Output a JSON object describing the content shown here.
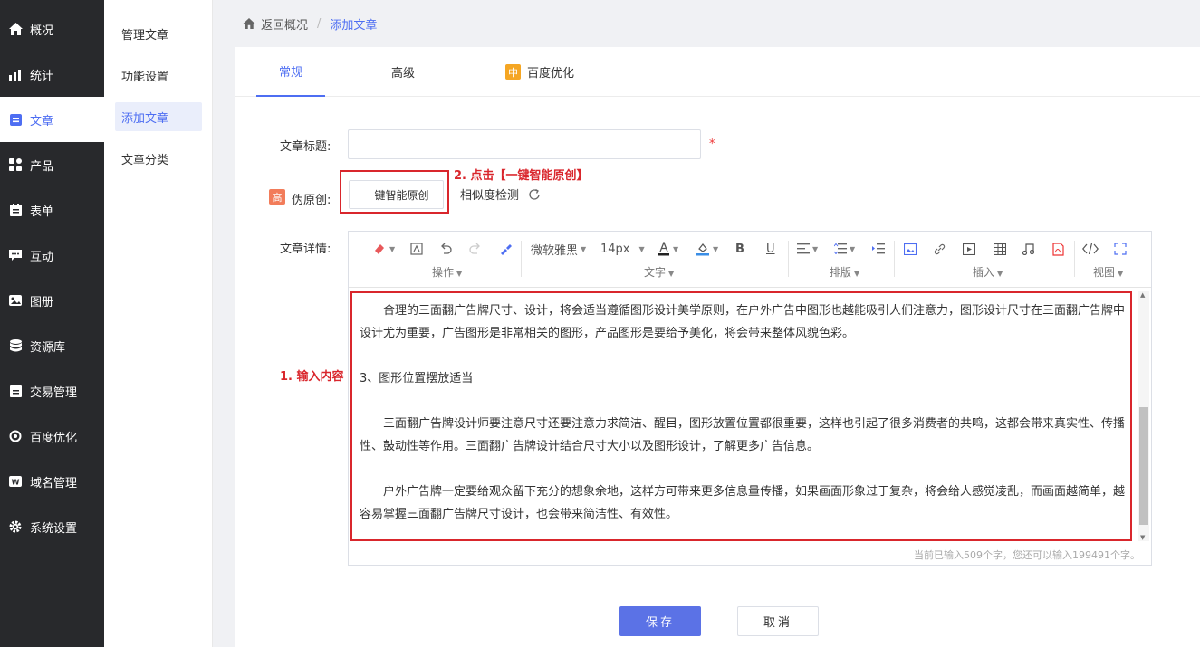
{
  "sidebar": {
    "items": [
      {
        "label": "概况",
        "icon": "home-icon"
      },
      {
        "label": "统计",
        "icon": "chart-icon"
      },
      {
        "label": "文章",
        "icon": "article-icon"
      },
      {
        "label": "产品",
        "icon": "product-icon"
      },
      {
        "label": "表单",
        "icon": "form-icon"
      },
      {
        "label": "互动",
        "icon": "chat-icon"
      },
      {
        "label": "图册",
        "icon": "gallery-icon"
      },
      {
        "label": "资源库",
        "icon": "database-icon"
      },
      {
        "label": "交易管理",
        "icon": "trade-icon"
      },
      {
        "label": "百度优化",
        "icon": "seo-icon"
      },
      {
        "label": "域名管理",
        "icon": "domain-icon"
      },
      {
        "label": "系统设置",
        "icon": "gear-icon"
      }
    ],
    "active": "文章"
  },
  "submenu": {
    "items": [
      "管理文章",
      "功能设置",
      "添加文章",
      "文章分类"
    ],
    "active": "添加文章"
  },
  "breadcrumb": {
    "back": "返回概况",
    "separator": "/",
    "current": "添加文章"
  },
  "tabs": {
    "general": "常规",
    "advanced": "高级",
    "seo_badge": "中",
    "seo": "百度优化"
  },
  "form": {
    "title_label": "文章标题:",
    "title_value": "",
    "required_mark": "*",
    "pseudo_badge": "高",
    "pseudo_label": "伪原创:",
    "ai_button": "一键智能原创",
    "similarity": "相似度检测",
    "detail_label": "文章详情:"
  },
  "annotations": {
    "step1": "1. 输入内容",
    "step2": "2. 点击【一键智能原创】"
  },
  "editor": {
    "font_family": "微软雅黑",
    "font_size": "14px",
    "groups": {
      "operation": "操作",
      "text": "文字",
      "layout": "排版",
      "insert": "插入",
      "view": "视图"
    },
    "paragraphs": [
      "合理的三面翻广告牌尺寸、设计，将会适当遵循图形设计美学原则，在户外广告中图形也越能吸引人们注意力，图形设计尺寸在三面翻广告牌中设计尤为重要，广告图形是非常相关的图形，产品图形是要给予美化，将会带来整体风貌色彩。",
      "3、图形位置摆放适当",
      "三面翻广告牌设计师要注意尺寸还要注意力求简洁、醒目，图形放置位置都很重要，这样也引起了很多消费者的共鸣，这都会带来真实性、传播性、鼓动性等作用。三面翻广告牌设计结合尺寸大小以及图形设计，了解更多广告信息。",
      "户外广告牌一定要给观众留下充分的想象余地，这样方可带来更多信息量传播，如果画面形象过于复杂，将会给人感觉凌乱，而画面越简单，越容易掌握三面翻广告牌尺寸设计，也会带来简洁性、有效性。"
    ],
    "char_count": "当前已输入509个字，您还可以输入199491个字。"
  },
  "actions": {
    "save": "保存",
    "cancel": "取消"
  },
  "colors": {
    "accent": "#4e6ef2",
    "sidebar_bg": "#28292c",
    "annotation_red": "#d9262c"
  }
}
